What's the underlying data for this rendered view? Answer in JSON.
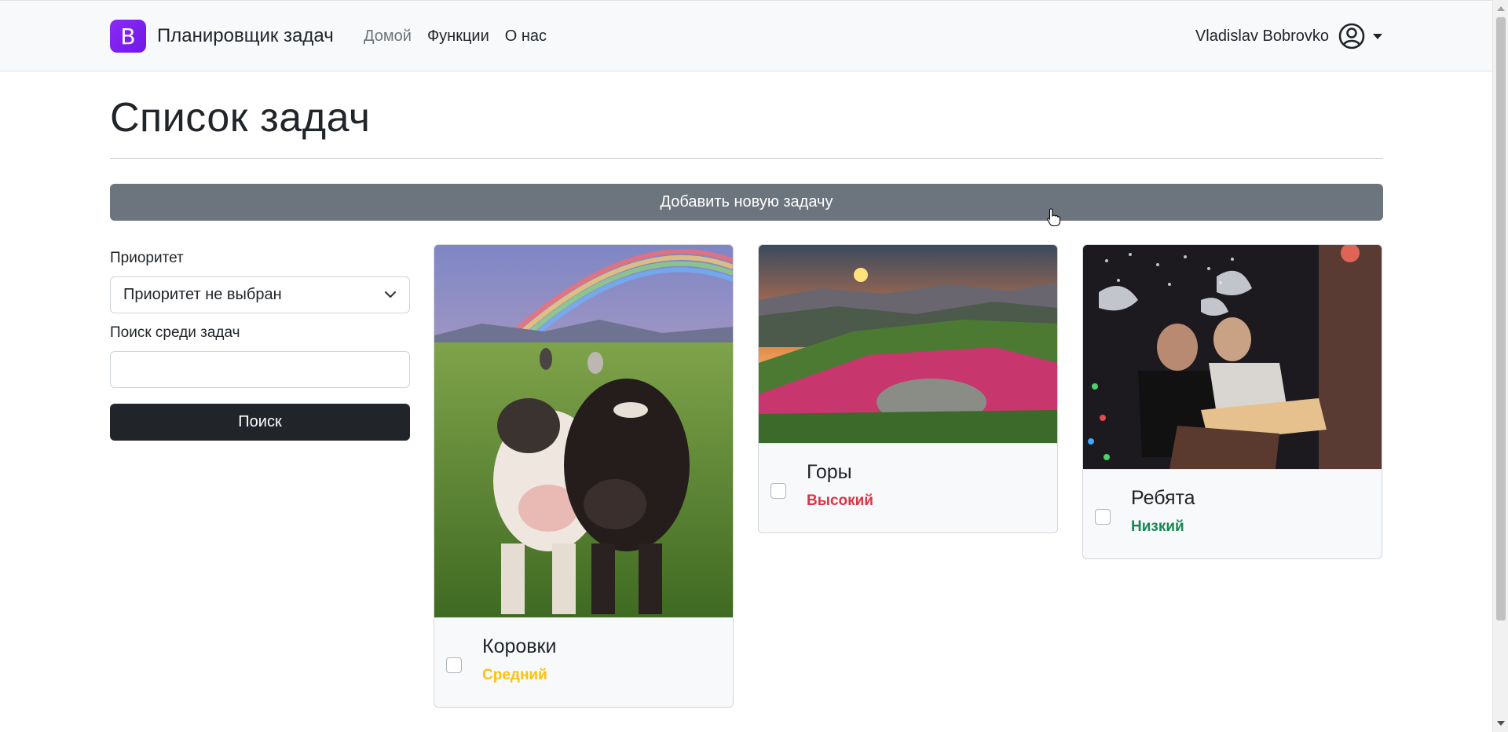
{
  "navbar": {
    "brand_logo": "B",
    "brand_text": "Планировщик задач",
    "links": [
      {
        "label": "Домой",
        "active": true
      },
      {
        "label": "Функции",
        "active": false
      },
      {
        "label": "О нас",
        "active": false
      }
    ],
    "user_name": "Vladislav Bobrovko",
    "avatar_icon": "user-circle-icon"
  },
  "header": {
    "title": "Список задач",
    "add_task_label": "Добавить новую задачу"
  },
  "filters": {
    "priority_label": "Приоритет",
    "priority_selected": "Приоритет не выбран",
    "search_label": "Поиск среди задач",
    "search_value": "",
    "search_button": "Поиск"
  },
  "cards": [
    {
      "title": "Коровки",
      "priority": "Средний",
      "priority_color": "#ffc107",
      "checked": false,
      "image": "cows-rainbow-photo"
    },
    {
      "title": "Горы",
      "priority": "Высокий",
      "priority_color": "#dc3545",
      "checked": false,
      "image": "mountain-sunset-photo"
    },
    {
      "title": "Ребята",
      "priority": "Низкий",
      "priority_color": "#198754",
      "checked": false,
      "image": "friends-party-photo"
    }
  ],
  "colors": {
    "brand": "#7016e8",
    "secondary_button": "#6c757d",
    "dark_button": "#212529",
    "navbar_bg": "#f8f9fa"
  }
}
